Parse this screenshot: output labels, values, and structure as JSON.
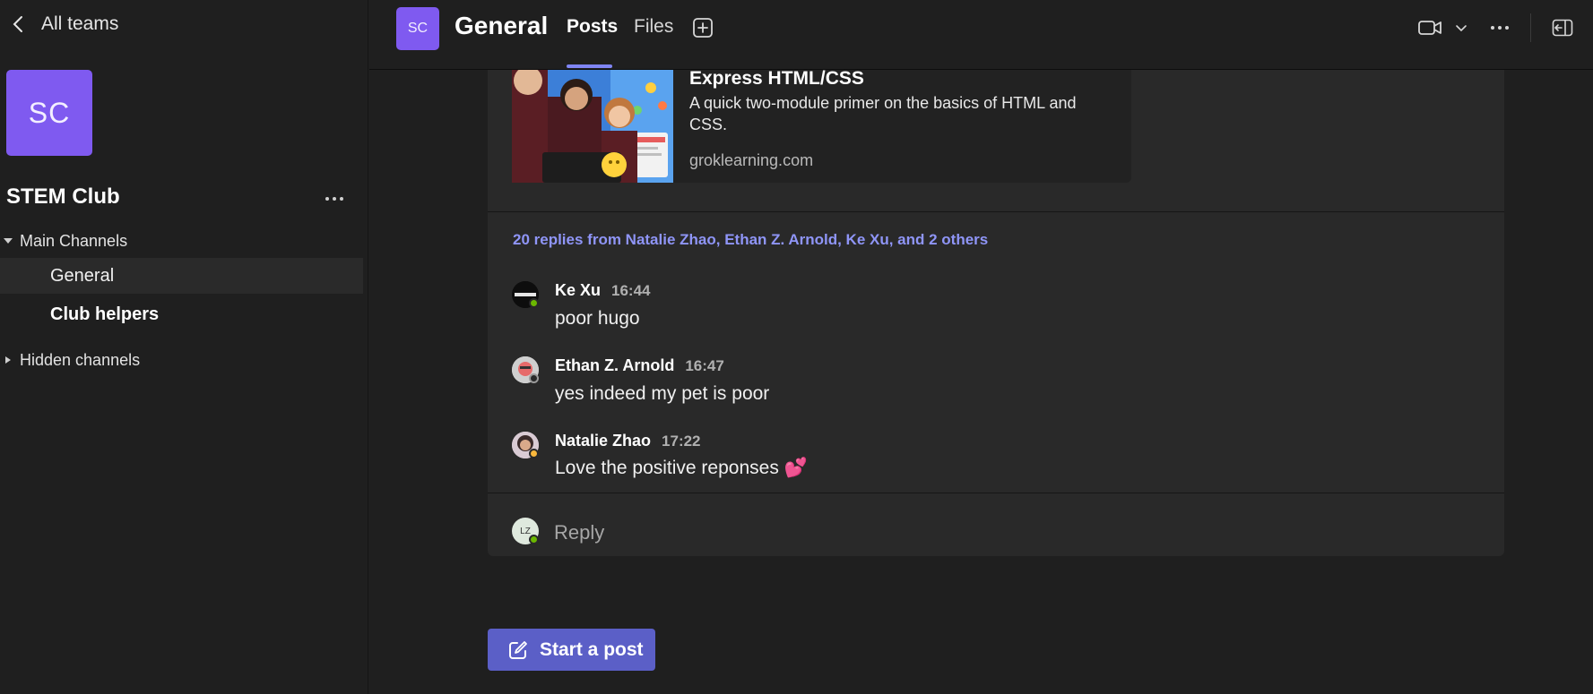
{
  "sidebar": {
    "back_label": "All teams",
    "team_initials": "SC",
    "team_name": "STEM Club",
    "groups": [
      {
        "label": "Main Channels",
        "expanded": true,
        "channels": [
          {
            "label": "General",
            "selected": true,
            "unread": false
          },
          {
            "label": "Club helpers",
            "selected": false,
            "unread": true
          }
        ]
      },
      {
        "label": "Hidden channels",
        "expanded": false
      }
    ]
  },
  "header": {
    "channel_initials": "SC",
    "channel_name": "General",
    "tabs": [
      {
        "label": "Posts",
        "active": true
      },
      {
        "label": "Files",
        "active": false
      }
    ],
    "icons": [
      "add-tab-icon",
      "video-call-icon",
      "chevron-down-icon",
      "more-icon",
      "open-side-panel-icon"
    ]
  },
  "post": {
    "link_card": {
      "title": "Express HTML/CSS",
      "description": "A quick two-module primer on the basics of HTML and CSS.",
      "domain": "groklearning.com"
    },
    "replies_summary": "20 replies from Natalie Zhao, Ethan Z. Arnold, Ke Xu, and 2 others",
    "replies": [
      {
        "author": "Ke Xu",
        "time": "16:44",
        "text": "poor hugo",
        "presence": "available"
      },
      {
        "author": "Ethan Z. Arnold",
        "time": "16:47",
        "text": "yes indeed my pet is poor",
        "presence": "offline"
      },
      {
        "author": "Natalie Zhao",
        "time": "17:22",
        "text": "Love the positive reponses 💕",
        "presence": "away"
      }
    ],
    "reply_box": {
      "avatar_initials": "LZ",
      "placeholder": "Reply"
    }
  },
  "start_post_label": "Start a post",
  "colors": {
    "accent": "#7f5af0",
    "link": "#8f95f7",
    "button": "#5b5fc7",
    "available": "#6bb700",
    "away": "#f8b73c"
  }
}
